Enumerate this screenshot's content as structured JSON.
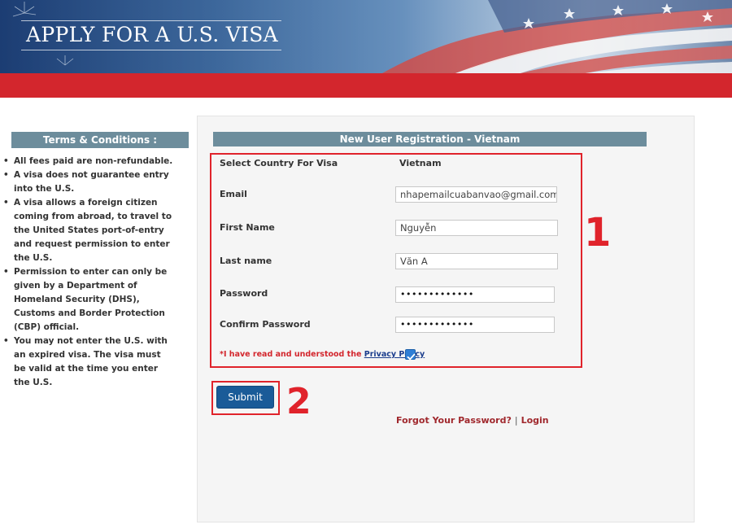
{
  "header": {
    "title": "APPLY FOR A U.S. VISA"
  },
  "sidebar": {
    "heading": "Terms & Conditions :",
    "terms": [
      "All fees paid are non-refundable.",
      "A visa does not guarantee entry into the U.S.",
      "A visa allows a foreign citizen coming from abroad, to travel to the United States port-of-entry and request permission to enter the U.S.",
      "Permission to enter can only be given by a Department of Homeland Security (DHS), Customs and Border Protection (CBP) official.",
      "You may not enter the U.S. with an expired visa. The visa must be valid at the time you enter the U.S."
    ]
  },
  "form": {
    "heading": "New User Registration - Vietnam",
    "country_label": "Select Country For Visa",
    "country_value": "Vietnam",
    "email_label": "Email",
    "email_value": "nhapemailcuabanvao@gmail.com",
    "first_name_label": "First Name",
    "first_name_value": "Nguyễn",
    "last_name_label": "Last name",
    "last_name_value": "Văn A",
    "password_label": "Password",
    "password_value": "•••••••••••••",
    "confirm_password_label": "Confirm Password",
    "confirm_password_value": "•••••••••••••",
    "privacy_prefix": "*I have read and understood the ",
    "privacy_link": "Privacy Policy",
    "privacy_checked": true,
    "submit_label": "Submit",
    "forgot_password_link": "Forgot Your Password?",
    "separator": "|",
    "login_link": "Login"
  },
  "annotations": {
    "step_1": "1",
    "step_2": "2",
    "highlight_color": "#e0232b"
  },
  "colors": {
    "header_red_band": "#d3262d",
    "section_heading_bg": "#6d8d9c",
    "submit_button": "#1a5b98",
    "link_red": "#a0282d"
  }
}
